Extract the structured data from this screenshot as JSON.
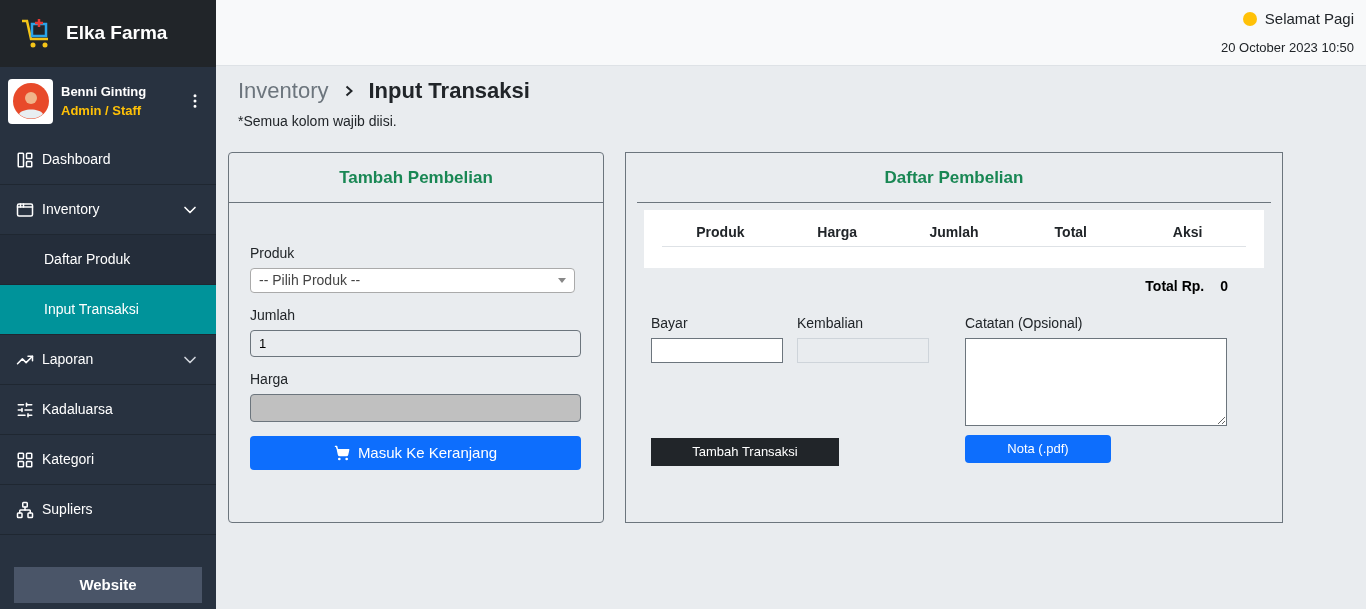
{
  "brand": {
    "name": "Elka Farma"
  },
  "user": {
    "name": "Benni Ginting",
    "role": "Admin / Staff"
  },
  "menu": [
    {
      "label": "Dashboard",
      "selected": false
    },
    {
      "label": "Inventory",
      "selected": false,
      "expanded": true,
      "children": [
        {
          "label": "Daftar Produk",
          "selected": false
        },
        {
          "label": "Input Transaksi",
          "selected": true
        }
      ]
    },
    {
      "label": "Laporan",
      "selected": false,
      "expanded": false
    },
    {
      "label": "Kadaluarsa",
      "selected": false
    },
    {
      "label": "Kategori",
      "selected": false
    },
    {
      "label": "Supliers",
      "selected": false
    }
  ],
  "website_button": "Website",
  "header": {
    "greeting": "Selamat Pagi",
    "datetime": "20 October 2023 10:50"
  },
  "breadcrumb": [
    "Inventory",
    "Input Transaksi"
  ],
  "note": "*Semua kolom wajib diisi.",
  "add_card": {
    "title": "Tambah Pembelian",
    "product_label": "Produk",
    "product_select": "-- Pilih Produk --",
    "qty_label": "Jumlah",
    "qty_value": "1",
    "price_label": "Harga",
    "price_disabled": true,
    "button": "Masuk Ke Keranjang"
  },
  "list_card": {
    "title": "Daftar Pembelian",
    "columns": [
      "Produk",
      "Harga",
      "Jumlah",
      "Total",
      "Aksi"
    ],
    "total_label": "Total Rp.",
    "total_value": "0",
    "pay_label": "Bayar",
    "change_label": "Kembalian",
    "change_disabled": true,
    "notes_label": "Catatan (Opsional)",
    "submit_button": "Tambah Transaksi",
    "pdf_button": "Nota (.pdf)"
  }
}
